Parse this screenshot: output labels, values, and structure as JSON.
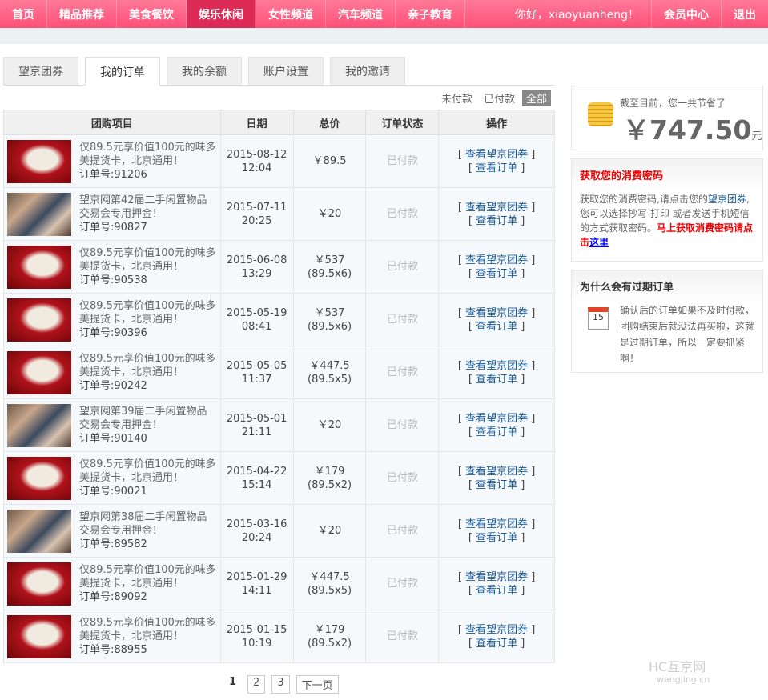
{
  "nav": {
    "items": [
      "首页",
      "精品推荐",
      "美食餐饮",
      "娱乐休闲",
      "女性频道",
      "汽车频道",
      "亲子教育"
    ],
    "active": 3,
    "greeting": "你好，xiaoyuanheng！",
    "member": "会员中心",
    "logout": "退出"
  },
  "tabs": {
    "items": [
      "望京团券",
      "我的订单",
      "我的余额",
      "账户设置",
      "我的邀请"
    ],
    "active": 1
  },
  "filters": {
    "items": [
      "未付款",
      "已付款",
      "全部"
    ],
    "active": 2
  },
  "table": {
    "headers": [
      "团购项目",
      "日期",
      "总价",
      "订单状态",
      "操作"
    ],
    "op1": "查看望京团券",
    "op2": "查看订单",
    "rows": [
      {
        "thumb": "wdm",
        "title": "仅89.5元享价值100元的味多美提货卡，北京通用！",
        "order": "订单号:91206",
        "date": "2015-08-12",
        "time": "12:04",
        "price": "￥89.5",
        "detail": "",
        "status": "已付款"
      },
      {
        "thumb": "market",
        "title": "望京网第42届二手闲置物品交易会专用押金！",
        "order": "订单号:90827",
        "date": "2015-07-11",
        "time": "20:25",
        "price": "￥20",
        "detail": "",
        "status": "已付款"
      },
      {
        "thumb": "wdm",
        "title": "仅89.5元享价值100元的味多美提货卡，北京通用！",
        "order": "订单号:90538",
        "date": "2015-06-08",
        "time": "13:29",
        "price": "￥537",
        "detail": "(89.5x6)",
        "status": "已付款"
      },
      {
        "thumb": "wdm",
        "title": "仅89.5元享价值100元的味多美提货卡，北京通用！",
        "order": "订单号:90396",
        "date": "2015-05-19",
        "time": "08:41",
        "price": "￥537",
        "detail": "(89.5x6)",
        "status": "已付款"
      },
      {
        "thumb": "wdm",
        "title": "仅89.5元享价值100元的味多美提货卡，北京通用！",
        "order": "订单号:90242",
        "date": "2015-05-05",
        "time": "11:37",
        "price": "￥447.5",
        "detail": "(89.5x5)",
        "status": "已付款"
      },
      {
        "thumb": "market",
        "title": "望京网第39届二手闲置物品交易会专用押金！",
        "order": "订单号:90140",
        "date": "2015-05-01",
        "time": "21:11",
        "price": "￥20",
        "detail": "",
        "status": "已付款"
      },
      {
        "thumb": "wdm",
        "title": "仅89.5元享价值100元的味多美提货卡，北京通用！",
        "order": "订单号:90021",
        "date": "2015-04-22",
        "time": "15:14",
        "price": "￥179",
        "detail": "(89.5x2)",
        "status": "已付款"
      },
      {
        "thumb": "market",
        "title": "望京网第38届二手闲置物品交易会专用押金！",
        "order": "订单号:89582",
        "date": "2015-03-16",
        "time": "20:24",
        "price": "￥20",
        "detail": "",
        "status": "已付款"
      },
      {
        "thumb": "wdm",
        "title": "仅89.5元享价值100元的味多美提货卡，北京通用！",
        "order": "订单号:89092",
        "date": "2015-01-29",
        "time": "14:11",
        "price": "￥447.5",
        "detail": "(89.5x5)",
        "status": "已付款"
      },
      {
        "thumb": "wdm",
        "title": "仅89.5元享价值100元的味多美提货卡，北京通用！",
        "order": "订单号:88955",
        "date": "2015-01-15",
        "time": "10:19",
        "price": "￥179",
        "detail": "(89.5x2)",
        "status": "已付款"
      }
    ]
  },
  "pager": {
    "pages": [
      "1",
      "2",
      "3"
    ],
    "current": "1",
    "next": "下一页"
  },
  "savings": {
    "label": "截至目前，您一共节省了",
    "currency": "￥",
    "amount": "747.50",
    "unit": "元"
  },
  "code_box": {
    "title": "获取您的消费密码",
    "text1": "获取您的消费密码,请点击您的",
    "link1": "望京团券",
    "text2": ",您可以选择抄写 打印 或者发送手机短信的方式获取密码。",
    "red": "马上获取消费密码请点击",
    "link2": "这里"
  },
  "expire_box": {
    "title": "为什么会有过期订单",
    "calendar_day": "15",
    "text": "确认后的订单如果不及时付款，团购结束后就没法再买啦，这就是过期订单，所以一定要抓紧啊！"
  },
  "watermark": {
    "logo": "HC互京网",
    "url": "wangjing.cn"
  }
}
